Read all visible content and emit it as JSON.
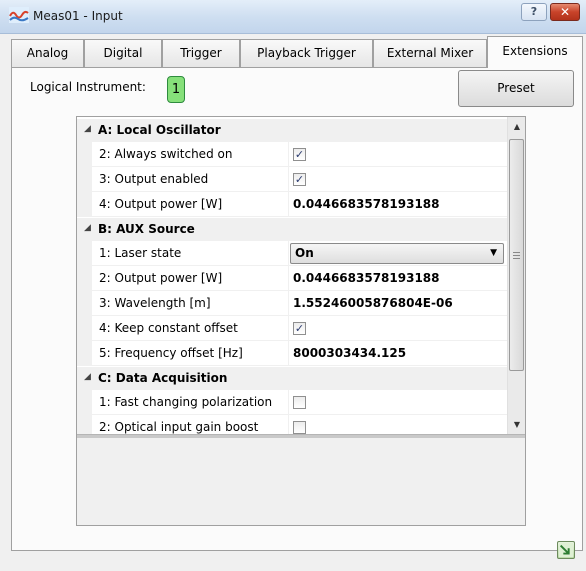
{
  "window": {
    "title": "Meas01 - Input",
    "help_label": "?",
    "close_label": "✕",
    "icon": "app-wave-icon"
  },
  "tabs": [
    {
      "label": "Analog",
      "active": false
    },
    {
      "label": "Digital",
      "active": false
    },
    {
      "label": "Trigger",
      "active": false
    },
    {
      "label": "Playback Trigger",
      "active": false
    },
    {
      "label": "External Mixer",
      "active": false
    },
    {
      "label": "Extensions",
      "active": true
    }
  ],
  "logical_instrument": {
    "label": "Logical Instrument:",
    "value": "1"
  },
  "preset_button": {
    "label": "Preset"
  },
  "property_grid": {
    "categories": [
      {
        "label": "A: Local Oscillator",
        "properties": [
          {
            "name": "2: Always switched on",
            "type": "checkbox",
            "checked": true
          },
          {
            "name": "3: Output enabled",
            "type": "checkbox",
            "checked": true
          },
          {
            "name": "4: Output power [W]",
            "type": "text",
            "value": "0.0446683578193188"
          }
        ]
      },
      {
        "label": "B: AUX Source",
        "properties": [
          {
            "name": "1: Laser state",
            "type": "dropdown",
            "value": "On"
          },
          {
            "name": "2: Output power [W]",
            "type": "text",
            "value": "0.0446683578193188"
          },
          {
            "name": "3: Wavelength [m]",
            "type": "text",
            "value": "1.55246005876804E-06"
          },
          {
            "name": "4: Keep constant offset",
            "type": "checkbox",
            "checked": true
          },
          {
            "name": "5: Frequency offset [Hz]",
            "type": "text",
            "value": "8000303434.125"
          }
        ]
      },
      {
        "label": "C: Data Acquisition",
        "properties": [
          {
            "name": "1: Fast changing polarization",
            "type": "checkbox",
            "checked": false
          },
          {
            "name": "2: Optical input gain boost",
            "type": "checkbox",
            "checked": false
          }
        ]
      }
    ]
  },
  "status_bar": {
    "icon": "export-arrow-icon"
  },
  "colors": {
    "badge_green": "#86e07a",
    "close_red": "#c8432a",
    "titlebar_blue": "#cfdff1"
  }
}
